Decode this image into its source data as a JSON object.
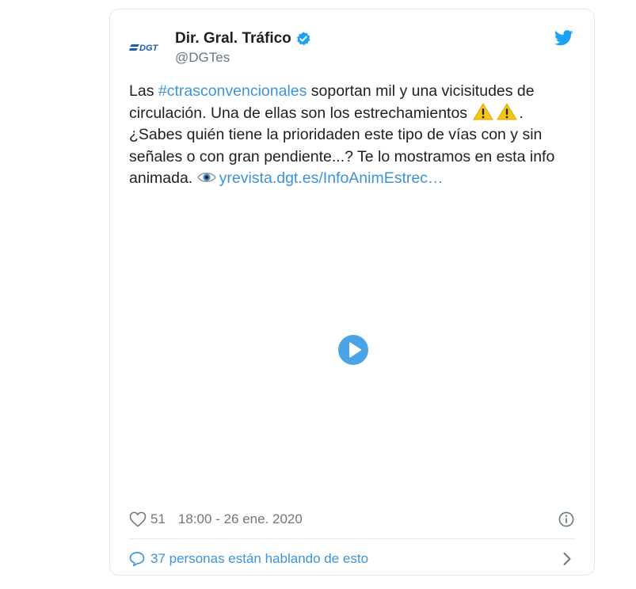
{
  "account": {
    "display_name": "Dir. Gral. Tráfico",
    "handle": "@DGTes",
    "logo_text": "DGT"
  },
  "tweet": {
    "text_pre": "Las ",
    "hashtag": "#ctrasconvencionales",
    "text_mid": " soportan mil y una vicisitudes de circulación. Una de ellas son los estrechamientos ",
    "text_after_emoji": ". ¿Sabes quién tiene la prioridaden este tipo de vías con y sin señales o con gran pendiente...? Te lo mostramos en esta info animada. ",
    "link": "yrevista.dgt.es/InfoAnimEstrec…"
  },
  "footer": {
    "like_count": "51",
    "timestamp": "18:00 - 26 ene. 2020"
  },
  "conversation": {
    "label": "37 personas están hablando de esto"
  },
  "colors": {
    "accent": "#3b94d9",
    "play": "#4aa3e6",
    "warning": "#f5c518",
    "muted": "#697882"
  },
  "icons": [
    "dgt-logo",
    "verified-badge-icon",
    "twitter-bird-icon",
    "warning-icon",
    "eye-icon",
    "play-icon",
    "heart-icon",
    "info-icon",
    "speech-bubble-icon",
    "chevron-right-icon"
  ]
}
